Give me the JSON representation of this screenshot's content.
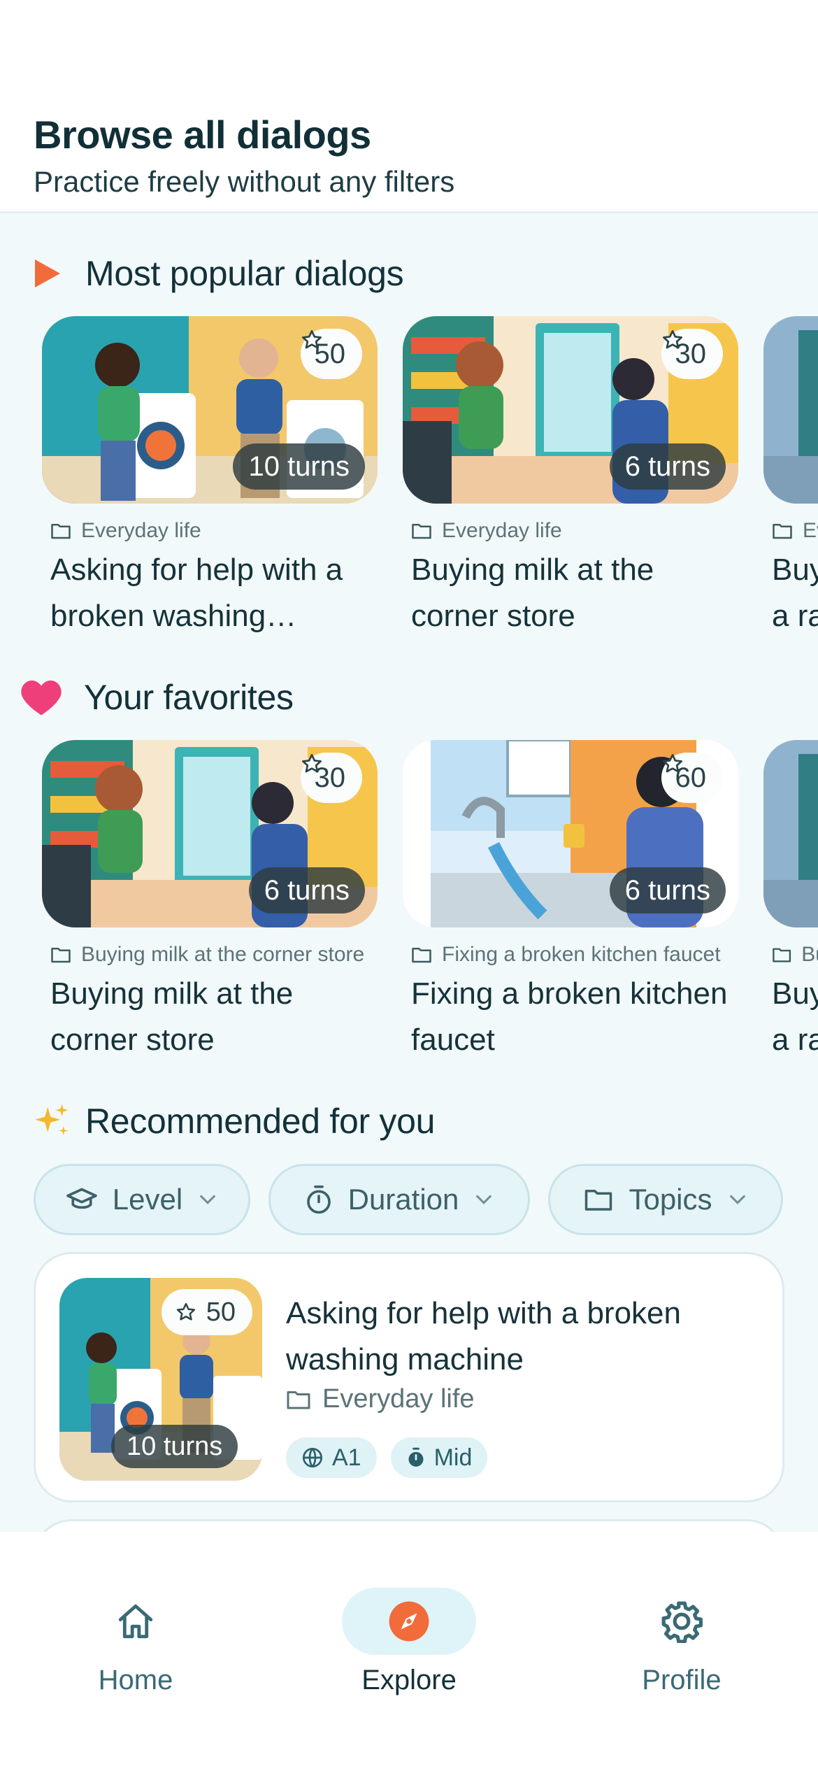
{
  "header": {
    "title": "Browse all dialogs",
    "subtitle": "Practice freely without any filters"
  },
  "sections": {
    "popular": {
      "title": "Most popular dialogs",
      "icon": "play-triangle-icon",
      "cards": [
        {
          "stars": "50",
          "turns": "10 turns",
          "category": "Everyday life",
          "title": "Asking for help with a broken washing machine",
          "scene": "laundry"
        },
        {
          "stars": "30",
          "turns": "6 turns",
          "category": "Everyday life",
          "title": "Buying milk at the corner store",
          "scene": "store"
        },
        {
          "stars": "",
          "turns": "",
          "category": "Everyday life",
          "title": "Buying an umbrella on a rainy day",
          "scene": "rain"
        }
      ]
    },
    "favorites": {
      "title": "Your favorites",
      "icon": "heart-icon",
      "cards": [
        {
          "stars": "30",
          "turns": "6 turns",
          "category": "Buying milk at the corner store",
          "title": "Buying milk at the corner store",
          "scene": "store"
        },
        {
          "stars": "60",
          "turns": "6 turns",
          "category": "Fixing a broken kitchen faucet",
          "title": "Fixing a broken kitchen faucet",
          "scene": "faucet"
        },
        {
          "stars": "",
          "turns": "",
          "category": "Buying an umbrella on a rainy day",
          "title": "Buying an umbrella on a rainy day",
          "scene": "rain"
        }
      ]
    },
    "recommended": {
      "title": "Recommended for you",
      "icon": "sparkles-icon",
      "filters": [
        {
          "label": "Level",
          "icon": "graduation-cap-icon"
        },
        {
          "label": "Duration",
          "icon": "stopwatch-icon"
        },
        {
          "label": "Topics",
          "icon": "folder-icon"
        }
      ],
      "card": {
        "stars": "50",
        "turns": "10 turns",
        "title": "Asking for help with a broken washing machine",
        "category": "Everyday life",
        "level": "A1",
        "duration": "Mid"
      }
    }
  },
  "nav": {
    "items": [
      {
        "label": "Home",
        "icon": "home-icon",
        "active": false
      },
      {
        "label": "Explore",
        "icon": "compass-icon",
        "active": true
      },
      {
        "label": "Profile",
        "icon": "gear-icon",
        "active": false
      }
    ]
  },
  "colors": {
    "accent_orange": "#f26b3a",
    "favorite_pink": "#ef3f7a",
    "sparkle_gold": "#f5b82e",
    "chip_bg": "#e5f4f7",
    "nav_active_bg": "#dff4f8"
  }
}
